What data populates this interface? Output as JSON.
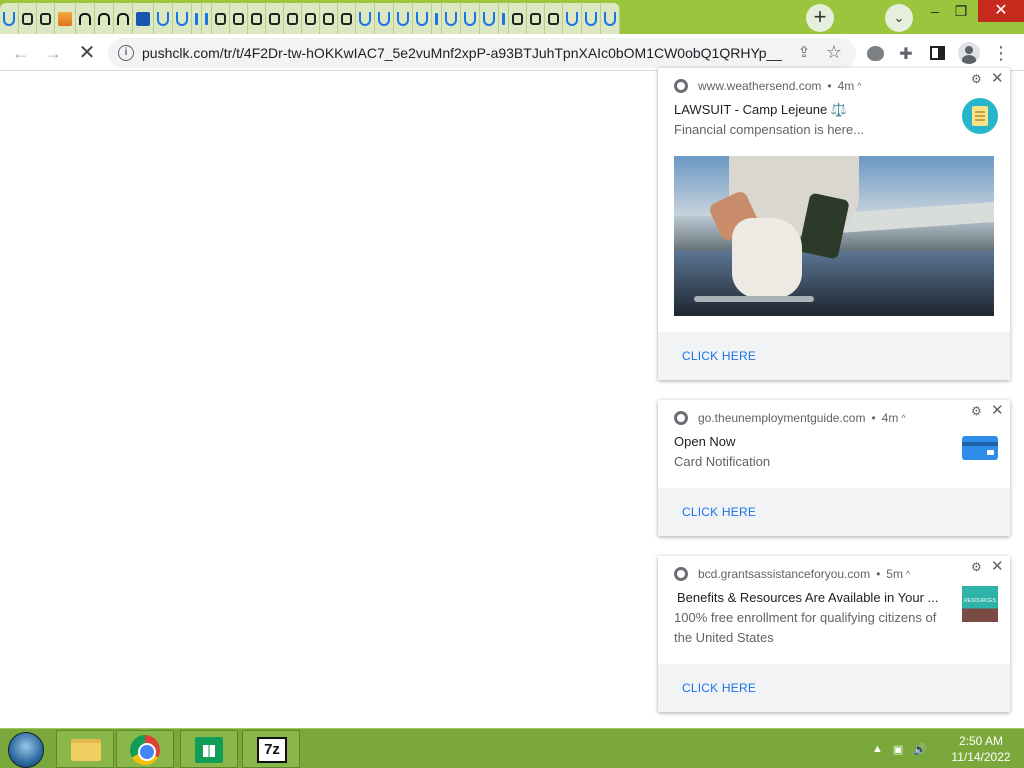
{
  "browser": {
    "tabs_count": 35,
    "address_bar": {
      "url": "pushclk.com/tr/t/4F2Dr-tw-hOKKwIAC7_5e2vuMnf2xpP-a93BTJuhTpnXAIc0bOM1CW0obQ1QRHYp__G..."
    },
    "window_controls": {
      "minimize": "–",
      "restore": "❐",
      "close": "✕"
    }
  },
  "notifications": [
    {
      "site": "www.weathersend.com",
      "age": "4m",
      "title": "LAWSUIT - Camp Lejeune ⚖️",
      "body": "Financial compensation is here...",
      "action": "CLICK HERE",
      "icon": "clipboard-icon",
      "image": "lab-worker-water-sample-image"
    },
    {
      "site": "go.theunemploymentguide.com",
      "age": "4m",
      "title": "Open Now",
      "body": "Card Notification",
      "action": "CLICK HERE",
      "icon": "credit-card-icon"
    },
    {
      "site": "bcd.grantsassistanceforyou.com",
      "age": "5m",
      "title": "Benefits & Resources Are Available in  Your ...",
      "body": "100% free enrollment for qualifying citizens of the United States",
      "action": "CLICK HERE",
      "icon": "resources-icon",
      "icon_text": "RESOURCES"
    }
  ],
  "taskbar": {
    "apps": [
      "file-explorer",
      "google-chrome",
      "windows-store",
      "7-zip"
    ],
    "app_7z_label": "7z",
    "clock": {
      "time": "2:50 AM",
      "date": "11/14/2022"
    }
  },
  "colors": {
    "tabstrip": "#9bc53d",
    "taskbar": "#7aa83a",
    "accent": "#1a73e8",
    "close_button": "#c42b1c"
  }
}
